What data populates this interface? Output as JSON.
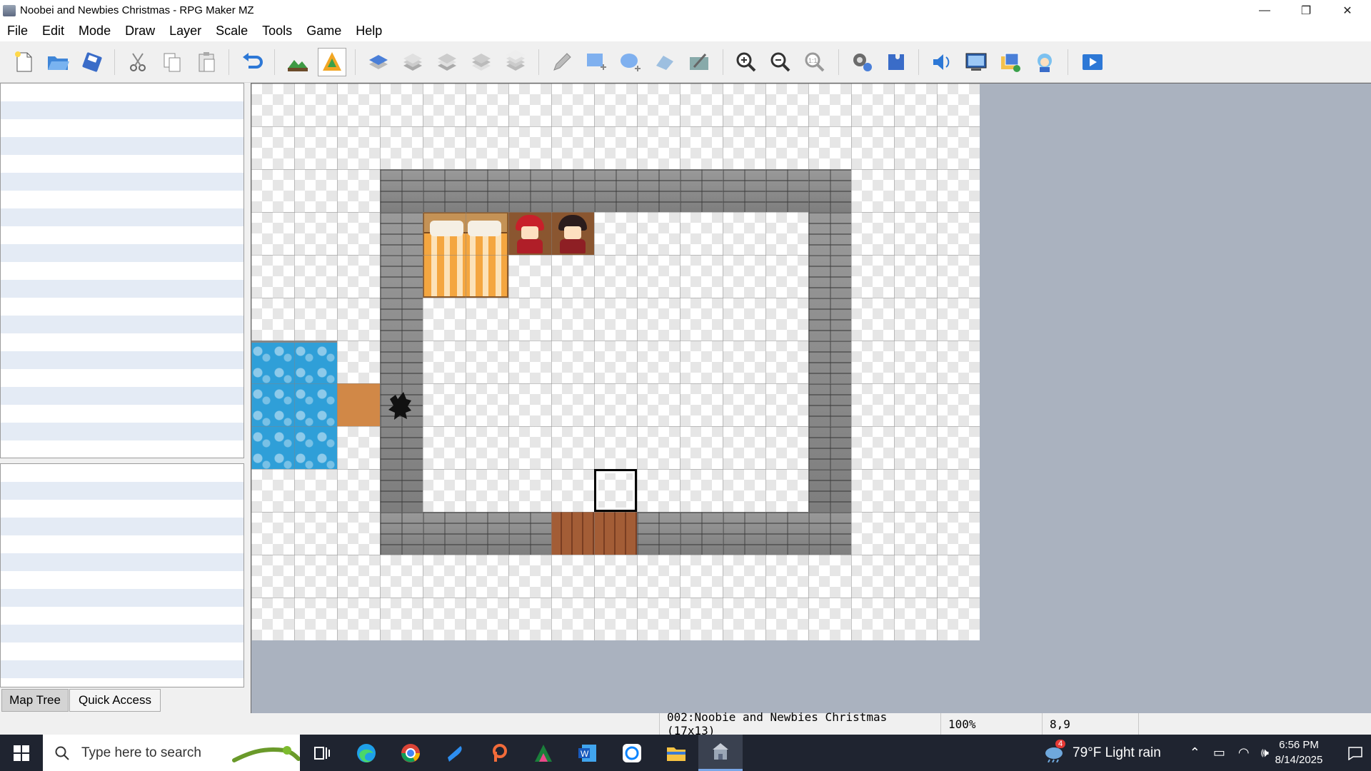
{
  "window": {
    "title": "Noobei and Newbies Christmas - RPG Maker MZ",
    "controls": {
      "minimize": "—",
      "restore": "❐",
      "close": "✕"
    }
  },
  "menu": [
    "File",
    "Edit",
    "Mode",
    "Draw",
    "Layer",
    "Scale",
    "Tools",
    "Game",
    "Help"
  ],
  "toolbar": {
    "buttons": [
      "new-project",
      "open-project",
      "save-project",
      "cut",
      "copy",
      "paste",
      "undo",
      "map-mode",
      "event-mode",
      "layer-1",
      "layer-2",
      "layer-3",
      "layer-4",
      "layer-auto",
      "pencil",
      "rectangle",
      "ellipse",
      "fill",
      "shadow-pen",
      "zoom-in",
      "zoom-out",
      "actual-size",
      "database",
      "plugin-manager",
      "sound-test",
      "event-searcher",
      "resource-manager",
      "character-generator",
      "playtest"
    ],
    "active": "event-mode"
  },
  "panels": {
    "tabs": [
      "Map Tree",
      "Quick Access"
    ],
    "active_tab": "Map Tree"
  },
  "map": {
    "name": "Noobie and Newbies Christmas",
    "width_tiles": 17,
    "height_tiles": 13,
    "selected_tile": "8,9"
  },
  "status": {
    "map_info": "002:Noobie and Newbies Christmas (17x13)",
    "zoom": "100%",
    "coords": "8,9"
  },
  "taskbar": {
    "search_placeholder": "Type here to search",
    "apps": [
      "task-view",
      "edge",
      "chrome",
      "vpn",
      "powerpoint-like",
      "sheets-app",
      "word",
      "messenger",
      "file-explorer",
      "rpg-maker"
    ],
    "active_app": "rpg-maker",
    "weather": "79°F  Light rain",
    "weather_badge": "4",
    "time": "6:56 PM",
    "date": "8/14/2025"
  },
  "colors": {
    "accent": "#0078d7",
    "taskbar_bg": "#1f2430",
    "map_bg": "#aab2bf"
  }
}
